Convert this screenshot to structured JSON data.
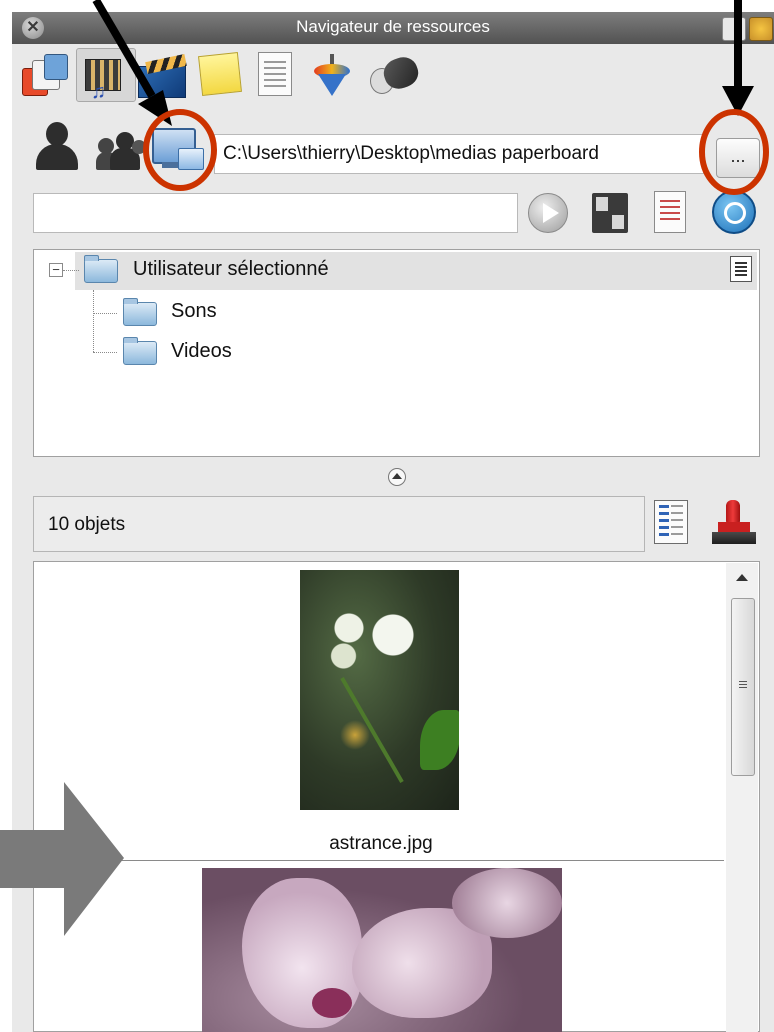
{
  "window": {
    "title": "Navigateur de ressources",
    "close_glyph": "✕"
  },
  "toolbar": {
    "icons": [
      "media-gallery-icon",
      "film-music-icon",
      "clapboard-icon",
      "sticky-note-icon",
      "document-icon",
      "spinning-top-icon",
      "mouse-device-icon"
    ]
  },
  "path_bar": {
    "path": "C:\\Users\\thierry\\Desktop\\medias paperboard",
    "browse_label": "..."
  },
  "search": {
    "value": ""
  },
  "tree": {
    "root_label": "Utilisateur sélectionné",
    "children": [
      "Sons",
      "Videos"
    ],
    "expander": "−"
  },
  "list_header": {
    "count_label": "10 objets"
  },
  "items": [
    {
      "caption": "astrance.jpg"
    }
  ],
  "annotation_colors": {
    "circle": "#cc3300",
    "arrow_black": "#000000",
    "arrow_gray": "#7a7a7a"
  }
}
